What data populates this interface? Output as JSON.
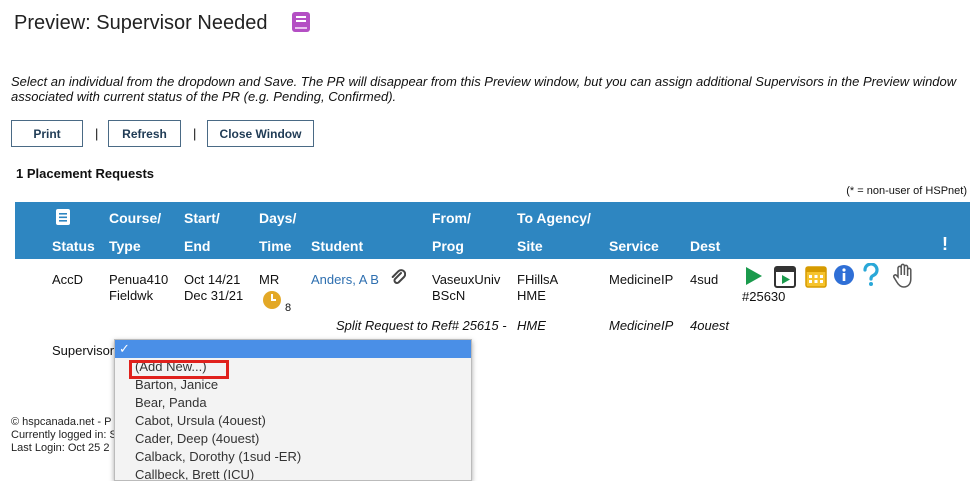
{
  "header": {
    "title": "Preview: Supervisor Needed"
  },
  "instructions": "Select an individual from the dropdown and Save. The PR will disappear from this Preview window, but you can assign additional Supervisors in the Preview window associated with current status of the PR (e.g. Pending, Confirmed).",
  "toolbar": {
    "print": "Print",
    "refresh": "Refresh",
    "close": "Close Window",
    "separator": "|"
  },
  "summary": "1 Placement Requests",
  "legend": "(* = non-user of HSPnet)",
  "table": {
    "headers": {
      "status": "Status",
      "course_top": "Course/",
      "course_bottom": "Type",
      "start_top": "Start/",
      "start_bottom": "End",
      "days_top": "Days/",
      "days_bottom": "Time",
      "student": "Student",
      "from_top": "From/",
      "from_bottom": "Prog",
      "to_top": "To Agency/",
      "to_bottom": "Site",
      "service": "Service",
      "dest": "Dest",
      "alert": "!"
    },
    "row": {
      "status": "AccD",
      "course": "Penua410",
      "type": "Fieldwk",
      "start": "Oct 14/21",
      "end": "Dec 31/21",
      "days": "MR",
      "time_count": "8",
      "student": "Anders, A B",
      "from": "VaseuxUniv",
      "prog": "BScN",
      "agency": "FHillsA",
      "site": "HME",
      "service": "MedicineIP",
      "dest": "4sud",
      "ref": "#25630"
    },
    "split": {
      "text": "Split Request to Ref# 25615 -",
      "site": "HME",
      "service": "MedicineIP",
      "dest": "4ouest"
    }
  },
  "supervisor": {
    "label": "Supervisor",
    "selected": "✓",
    "options": [
      "(Add New...)",
      "Barton, Janice",
      "Bear, Panda",
      "Cabot, Ursula (4ouest)",
      "Cader, Deep (4ouest)",
      "Calback, Dorothy (1sud -ER)",
      "Callbeck, Brett (ICU)"
    ]
  },
  "footer": {
    "copyright": "© hspcanada.net - P",
    "logged_in": "Currently logged in: S",
    "last_login": "Last Login: Oct 25 2"
  },
  "colors": {
    "header_bg": "#2e86c1",
    "link": "#2e6fb0",
    "highlight": "#e0211c",
    "book_icon": "#b44fc4"
  }
}
